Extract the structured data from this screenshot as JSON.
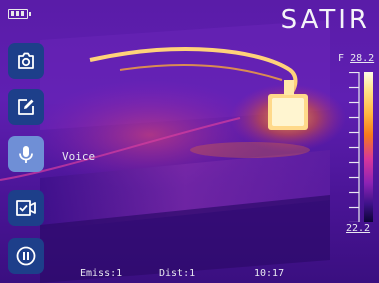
{
  "status_bar": {
    "battery_icon": "battery-full-icon",
    "brand": "SATIR"
  },
  "toolbar": {
    "items": [
      {
        "icon": "camera-icon",
        "label": "",
        "active": false
      },
      {
        "icon": "edit-icon",
        "label": "",
        "active": false
      },
      {
        "icon": "microphone-icon",
        "label": "Voice",
        "active": true
      },
      {
        "icon": "video-check-icon",
        "label": "",
        "active": false
      },
      {
        "icon": "pause-icon",
        "label": "",
        "active": false
      }
    ],
    "colors": {
      "button": "#1d3f8a",
      "active": "#6f8fd6"
    }
  },
  "scale": {
    "unit": "F",
    "max": "28.2",
    "min": "22.2"
  },
  "footer": {
    "emissivity": "Emiss:1",
    "distance": "Dist:1",
    "time": "10:17"
  }
}
